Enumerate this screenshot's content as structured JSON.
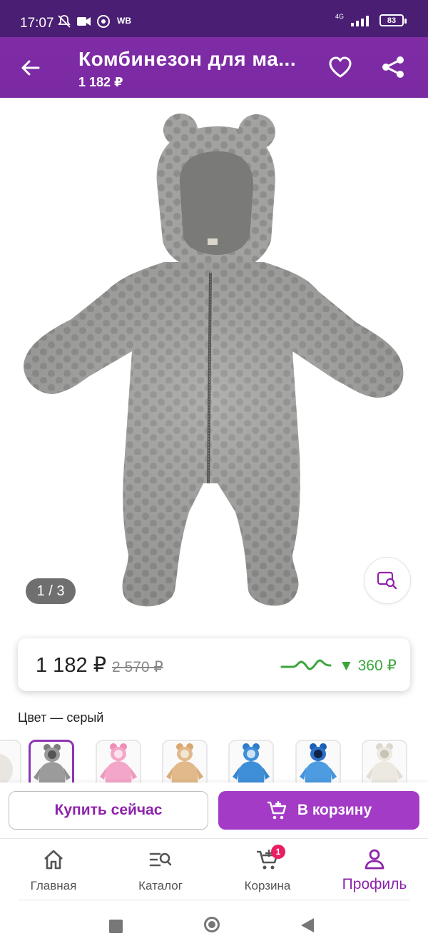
{
  "status_bar": {
    "time": "17:07",
    "carrier_label": "WB",
    "network": "4G",
    "battery": "83"
  },
  "header": {
    "title": "Комбинезон для ма...",
    "price": "1 182 ₽"
  },
  "gallery": {
    "counter": "1 / 3"
  },
  "price_card": {
    "price": "1 182 ₽",
    "old_price": "2 570 ₽",
    "drop": "▼ 360 ₽"
  },
  "color": {
    "label": "Цвет — серый"
  },
  "swatches": [
    {
      "name": "partial",
      "color": "#e9e6e1"
    },
    {
      "name": "gray",
      "color": "#9b9b9b"
    },
    {
      "name": "pink",
      "color": "#f3a6c8"
    },
    {
      "name": "beige",
      "color": "#e2b98a"
    },
    {
      "name": "blue",
      "color": "#3f8fd8"
    },
    {
      "name": "light-blue",
      "color": "#4d9be0"
    },
    {
      "name": "white",
      "color": "#ece9e1"
    }
  ],
  "actions": {
    "buy_now": "Купить сейчас",
    "add_to_cart": "В корзину"
  },
  "nav": {
    "home": "Главная",
    "catalog": "Каталог",
    "cart": "Корзина",
    "cart_badge": "1",
    "profile": "Профиль"
  },
  "colors": {
    "accent": "#a33bc6",
    "header": "#7b2aa4",
    "status_bar": "#4a1f73",
    "price_drop": "#3aa63a"
  }
}
